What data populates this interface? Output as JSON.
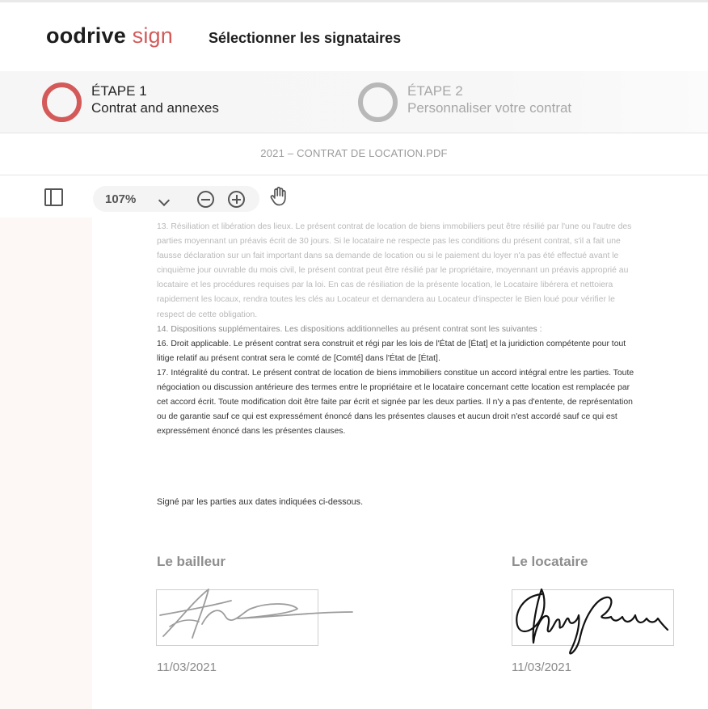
{
  "header": {
    "logo_brand": "oodrive",
    "logo_product": "sign",
    "title": "Sélectionner les signataires"
  },
  "steps": [
    {
      "number": "ÉTAPE 1",
      "label": "Contrat and annexes",
      "state": "active",
      "color": "#d45a5a"
    },
    {
      "number": "ÉTAPE 2",
      "label": "Personnaliser votre contrat",
      "state": "inactive",
      "color": "#b8b8b8"
    }
  ],
  "file": {
    "name": "2021 – CONTRAT DE LOCATION.PDF"
  },
  "toolbar": {
    "sidebar_icon": "sidebar-toggle-icon",
    "zoom": "107%",
    "zoom_dropdown_icon": "chevron-down-icon",
    "zoom_out_icon": "zoom-out-icon",
    "zoom_in_icon": "zoom-in-icon",
    "pan_icon": "hand-icon"
  },
  "document": {
    "paragraphs": [
      "13. Résiliation et libération des lieux.  Le présent contrat de location de biens immobiliers peut être résilié par l'une ou l'autre des parties moyennant un préavis écrit de 30 jours.  Si le locataire ne respecte pas les conditions du présent contrat, s'il a fait une fausse déclaration sur un fait important dans sa demande de location ou si le paiement du loyer n'a pas été effectué avant le cinquième jour ouvrable du mois civil, le présent contrat peut être résilié par le propriétaire, moyennant un préavis approprié au locataire et les procédures requises par la loi.  En cas de résiliation de la présente location, le Locataire libérera et nettoiera rapidement les locaux, rendra toutes les clés au Locateur et demandera au Locateur d'inspecter le Bien loué pour vérifier le respect de cette obligation.",
      "14. Dispositions supplémentaires.  Les dispositions additionnelles au présent contrat sont les suivantes :",
      "16. Droit applicable.  Le présent contrat sera construit et régi par les lois de l'État de [État] et la juridiction compétente pour tout litige relatif au présent contrat sera le comté de [Comté] dans l'État de [État].",
      "17. Intégralité du contrat.  Le présent contrat de location de biens immobiliers constitue un accord intégral entre les parties.  Toute négociation ou discussion antérieure des termes entre le propriétaire et le locataire concernant cette location est remplacée par cet accord écrit. Toute modification doit être faite par écrit et signée par les deux parties. Il n'y a pas d'entente, de représentation ou de garantie sauf ce qui est expressément énoncé dans les présentes clauses et aucun droit n'est accordé sauf ce qui est expressément énoncé dans les présentes clauses."
    ],
    "signed_line": "Signé par les parties aux dates indiquées ci-dessous."
  },
  "signatures": {
    "landlord": {
      "title": "Le bailleur",
      "date": "11/03/2021",
      "ink_color": "#9c9c9c"
    },
    "tenant": {
      "title": "Le locataire",
      "date": "11/03/2021",
      "ink_color": "#111111"
    }
  }
}
